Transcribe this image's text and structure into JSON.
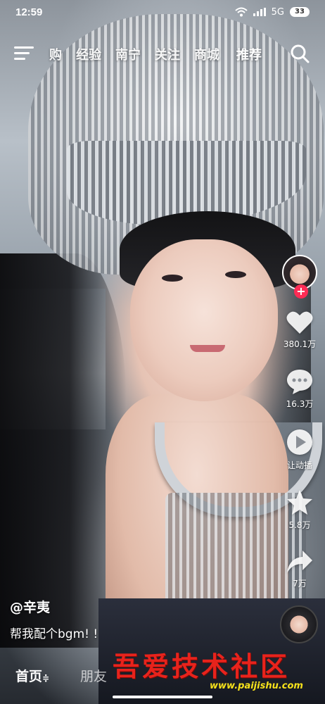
{
  "status_bar": {
    "time": "12:59",
    "network": "5G",
    "battery": "33"
  },
  "top_nav": {
    "tabs": [
      {
        "label": "购"
      },
      {
        "label": "经验"
      },
      {
        "label": "南宁"
      },
      {
        "label": "关注"
      },
      {
        "label": "商城"
      },
      {
        "label": "推荐"
      }
    ],
    "active_tab": "推荐"
  },
  "right_rail": {
    "follow_symbol": "+",
    "like_count": "380.1万",
    "comment_count": "16.3万",
    "share_label": "让动播",
    "favorite_count": "5.8万",
    "forward_count": "7万"
  },
  "caption": {
    "author": "@辛夷",
    "description": "帮我配个bgm! !"
  },
  "bottom_nav": {
    "home_label": "首页",
    "home_suffix": "≑",
    "friends_label": "朋友"
  },
  "watermark": {
    "text": "吾爱技术社区",
    "url": "www.paijishu.com"
  },
  "colors": {
    "accent": "#fe2c55",
    "watermark": "#e8231c",
    "watermark_url": "#f7e21b"
  }
}
